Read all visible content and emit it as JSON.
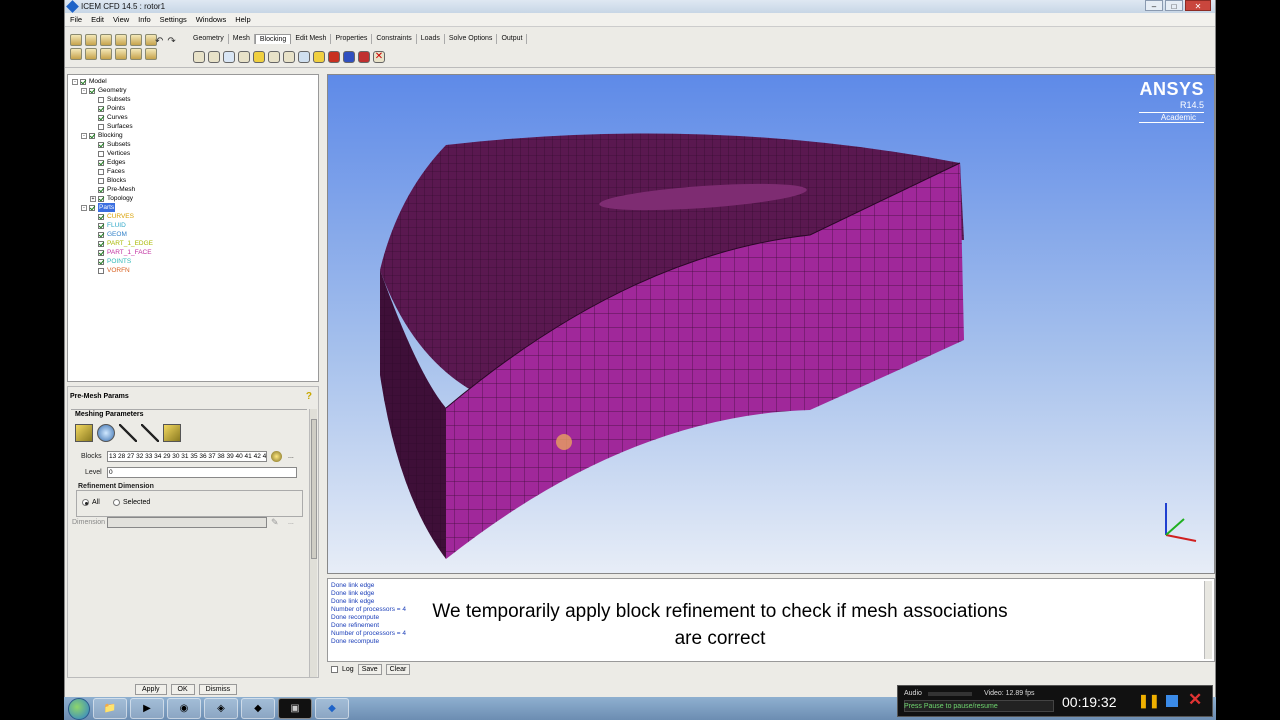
{
  "window": {
    "title": "ICEM CFD 14.5 : rotor1"
  },
  "menu": [
    "File",
    "Edit",
    "View",
    "Info",
    "Settings",
    "Windows",
    "Help"
  ],
  "tabs": [
    "Geometry",
    "Mesh",
    "Blocking",
    "Edit Mesh",
    "Properties",
    "Constraints",
    "Loads",
    "Solve Options",
    "Output"
  ],
  "active_tab": "Blocking",
  "tree": [
    {
      "label": "Model",
      "indent": 0,
      "checked": true,
      "expander": "-"
    },
    {
      "label": "Geometry",
      "indent": 1,
      "checked": true,
      "expander": "-"
    },
    {
      "label": "Subsets",
      "indent": 2,
      "checked": false
    },
    {
      "label": "Points",
      "indent": 2,
      "checked": true
    },
    {
      "label": "Curves",
      "indent": 2,
      "checked": true
    },
    {
      "label": "Surfaces",
      "indent": 2,
      "checked": false
    },
    {
      "label": "Blocking",
      "indent": 1,
      "checked": true,
      "expander": "-"
    },
    {
      "label": "Subsets",
      "indent": 2,
      "checked": true
    },
    {
      "label": "Vertices",
      "indent": 2,
      "checked": false
    },
    {
      "label": "Edges",
      "indent": 2,
      "checked": true
    },
    {
      "label": "Faces",
      "indent": 2,
      "checked": false
    },
    {
      "label": "Blocks",
      "indent": 2,
      "checked": false
    },
    {
      "label": "Pre-Mesh",
      "indent": 2,
      "checked": true
    },
    {
      "label": "Topology",
      "indent": 2,
      "checked": true,
      "expander": "+"
    },
    {
      "label": "Parts",
      "indent": 1,
      "checked": true,
      "expander": "-",
      "selected": true
    },
    {
      "label": "CURVES",
      "indent": 2,
      "checked": true,
      "color": "#d8a000"
    },
    {
      "label": "FLUID",
      "indent": 2,
      "checked": true,
      "color": "#2fa8c8"
    },
    {
      "label": "GEOM",
      "indent": 2,
      "checked": true,
      "color": "#2f7fc8"
    },
    {
      "label": "PART_1_EDGE",
      "indent": 2,
      "checked": true,
      "color": "#a8b800"
    },
    {
      "label": "PART_1_FACE",
      "indent": 2,
      "checked": true,
      "color": "#c02fa0"
    },
    {
      "label": "POINTS",
      "indent": 2,
      "checked": true,
      "color": "#2fb8b8"
    },
    {
      "label": "VORFN",
      "indent": 2,
      "checked": false,
      "color": "#d86020"
    }
  ],
  "panel": {
    "title": "Pre-Mesh Params",
    "group_title": "Meshing Parameters",
    "blocks_label": "Blocks",
    "blocks_value": "13 28 27 32 33 34 29 30 31 35 36 37 38 39 40 41 42 4...",
    "level_label": "Level",
    "level_value": "0",
    "refinement_title": "Refinement Dimension",
    "radio_all": "All",
    "radio_selected": "Selected",
    "dimension_label": "Dimension",
    "dots": "..."
  },
  "bottom_buttons": [
    "Apply",
    "OK",
    "Dismiss"
  ],
  "viewport": {
    "brand": "ANSYS",
    "version": "R14.5",
    "edition": "Academic"
  },
  "messages": [
    "Done link edge",
    "Done link edge",
    "Done link edge",
    "Number of processors = 4",
    "Done recompute",
    "Done refinement",
    "Number of processors = 4",
    "Done recompute"
  ],
  "message_controls": {
    "log": "Log",
    "save": "Save",
    "clear": "Clear"
  },
  "caption": "We temporarily apply block refinement to check if mesh associations are correct",
  "recorder": {
    "audio": "Audio",
    "video": "Video: 12.89 fps",
    "hint": "Press Pause to pause/resume",
    "time": "00:19:32"
  },
  "colors": {
    "mesh": "#a0289a",
    "mesh_top": "#7a1f6e",
    "viewport_top": "#5e8ae8"
  }
}
